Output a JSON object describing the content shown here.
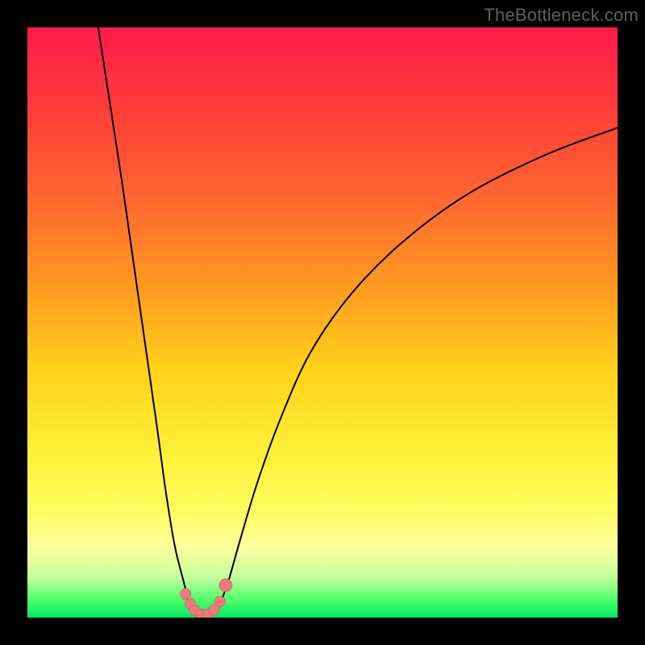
{
  "watermark": "TheBottleneck.com",
  "chart_data": {
    "type": "line",
    "title": "",
    "xlabel": "",
    "ylabel": "",
    "xlim": [
      0,
      100
    ],
    "ylim": [
      0,
      100
    ],
    "series": [
      {
        "name": "curve-left",
        "x": [
          12,
          14,
          16,
          18,
          20,
          22,
          23.5,
          25,
          26.5,
          27.5
        ],
        "y": [
          100,
          87,
          74,
          60,
          46,
          32,
          21,
          12,
          6,
          2
        ]
      },
      {
        "name": "curve-right",
        "x": [
          32.5,
          34,
          36,
          39,
          43,
          48,
          55,
          64,
          75,
          88,
          100
        ],
        "y": [
          2,
          6,
          13,
          23,
          34,
          45,
          55,
          64,
          72,
          78.5,
          83
        ]
      },
      {
        "name": "trough",
        "x": [
          27.5,
          28,
          29,
          30,
          31,
          32,
          32.5
        ],
        "y": [
          2,
          1.2,
          0.5,
          0.3,
          0.5,
          1.2,
          2
        ]
      }
    ],
    "markers": [
      {
        "x": 26.8,
        "y": 4.0,
        "r": 1.0
      },
      {
        "x": 27.6,
        "y": 2.3,
        "r": 1.0
      },
      {
        "x": 28.4,
        "y": 1.2,
        "r": 1.0
      },
      {
        "x": 29.4,
        "y": 0.55,
        "r": 1.0
      },
      {
        "x": 30.6,
        "y": 0.55,
        "r": 1.0
      },
      {
        "x": 31.6,
        "y": 1.3,
        "r": 1.0
      },
      {
        "x": 32.6,
        "y": 2.7,
        "r": 1.0
      },
      {
        "x": 33.6,
        "y": 5.5,
        "r": 1.2
      }
    ],
    "colors": {
      "curve": "#000000",
      "marker_fill": "#e97b78",
      "marker_stroke": "#d95c58"
    }
  }
}
